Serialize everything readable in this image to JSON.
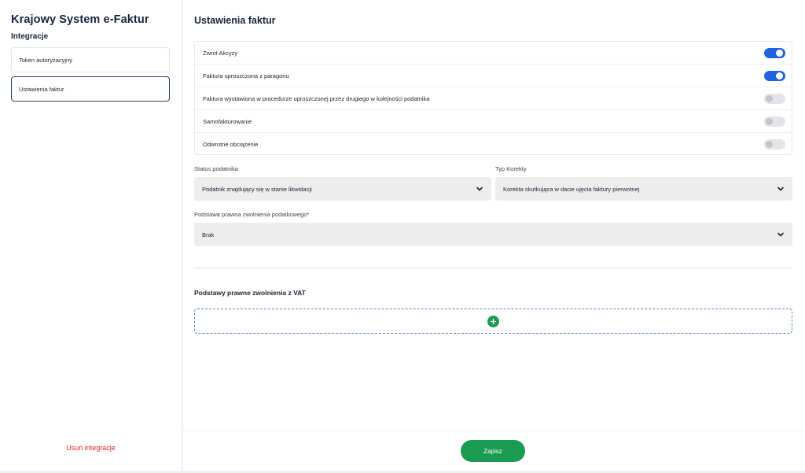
{
  "sidebar": {
    "title": "Krajowy System e-Faktur",
    "subtitle": "Integracje",
    "items": [
      {
        "label": "Token autoryzacyjny",
        "active": false
      },
      {
        "label": "Ustawienia faktur",
        "active": true
      }
    ],
    "delete_label": "Usuń integracje"
  },
  "main": {
    "title": "Ustawienia faktur",
    "toggles": [
      {
        "label": "Zwrot Akcyzy",
        "on": true
      },
      {
        "label": "Faktura uproszczona z paragonu",
        "on": true
      },
      {
        "label": "Faktura wystawiona w procedurze uproszczonej przez drugiego w kolejności podatnika",
        "on": false
      },
      {
        "label": "Samofakturowanie",
        "on": false
      },
      {
        "label": "Odwrotne obciążenie",
        "on": false
      }
    ],
    "status": {
      "label": "Status podatnika",
      "value": "Podatnik znajdujący się w stanie likwidacji"
    },
    "correction": {
      "label": "Typ Korekty",
      "value": "Korekta skutkująca w dacie ujęcia faktury pierwotnej"
    },
    "legal_basis": {
      "label": "Podstawa prawna zwolnienia podatkowego*",
      "value": "Brak"
    },
    "vat_section_title": "Podstawy prawne zwolnienia z VAT",
    "save_label": "Zapisz"
  },
  "colors": {
    "accent_blue": "#1f63e0",
    "success_green": "#1a9b52",
    "danger_red": "#e0262a"
  },
  "icons": {
    "select_chevron": "chevron-down-icon",
    "add": "plus-icon"
  }
}
